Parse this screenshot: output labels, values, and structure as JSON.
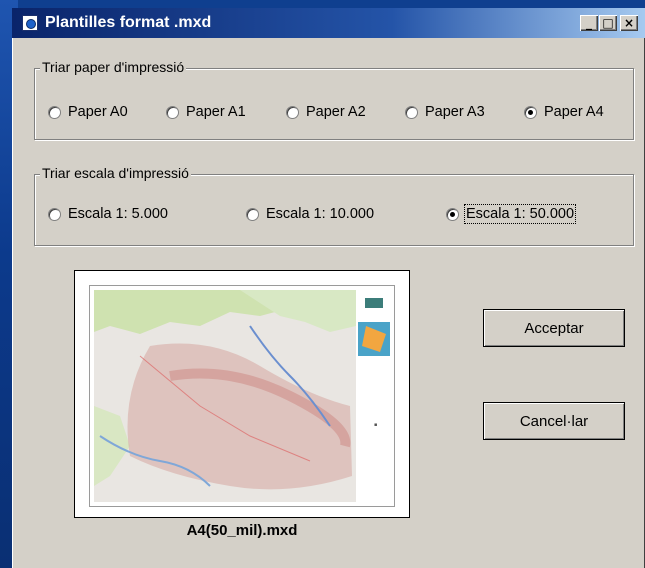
{
  "window": {
    "title": "Plantilles format .mxd",
    "controls": {
      "minimize": "_",
      "maximize": "□",
      "close": "×"
    }
  },
  "paper_group": {
    "legend": "Triar paper d'impressió",
    "options": [
      {
        "label": "Paper A0",
        "selected": false
      },
      {
        "label": "Paper A1",
        "selected": false
      },
      {
        "label": "Paper A2",
        "selected": false
      },
      {
        "label": "Paper A3",
        "selected": false
      },
      {
        "label": "Paper A4",
        "selected": true
      }
    ]
  },
  "scale_group": {
    "legend": "Triar escala d'impressió",
    "options": [
      {
        "label": "Escala 1: 5.000",
        "selected": false
      },
      {
        "label": "Escala 1: 10.000",
        "selected": false
      },
      {
        "label": "Escala 1: 50.000",
        "selected": true
      }
    ]
  },
  "preview": {
    "caption": "A4(50_mil).mxd"
  },
  "buttons": {
    "accept": "Acceptar",
    "cancel": "Cancel·lar"
  },
  "icons": [
    "app-icon",
    "minimize-icon",
    "maximize-icon",
    "close-icon"
  ]
}
